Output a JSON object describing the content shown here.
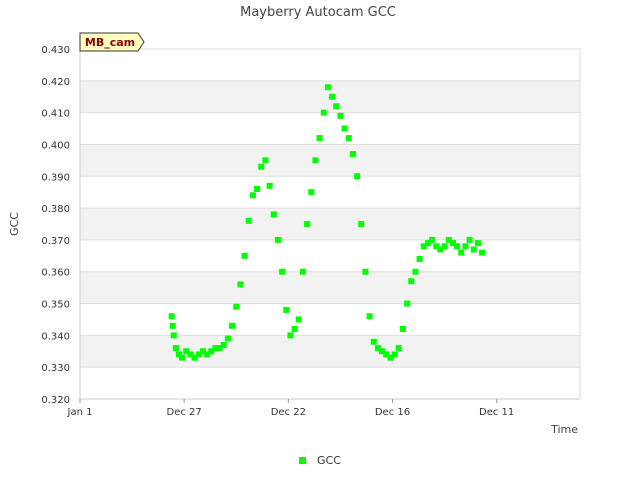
{
  "chart_data": {
    "type": "scatter",
    "title": "Mayberry Autocam GCC",
    "xlabel": "Time",
    "ylabel": "GCC",
    "ylim": [
      0.32,
      0.43
    ],
    "yticks": [
      "0.320",
      "0.330",
      "0.340",
      "0.350",
      "0.360",
      "0.370",
      "0.380",
      "0.390",
      "0.400",
      "0.410",
      "0.420",
      "0.430"
    ],
    "xlim": [
      0,
      24
    ],
    "xticks": [
      {
        "x": 0,
        "label": "Jan 1"
      },
      {
        "x": 5,
        "label": "Dec 27"
      },
      {
        "x": 10,
        "label": "Dec 22"
      },
      {
        "x": 15,
        "label": "Dec 16"
      },
      {
        "x": 20,
        "label": "Dec 11"
      }
    ],
    "grid": true,
    "legend_position": "bottom-center",
    "badge_label": "MB_cam",
    "series": [
      {
        "name": "GCC",
        "color": "#00ff00",
        "x": [
          4.4,
          4.45,
          4.5,
          4.6,
          4.75,
          4.9,
          5.1,
          5.3,
          5.5,
          5.7,
          5.9,
          6.1,
          6.3,
          6.5,
          6.7,
          6.9,
          7.1,
          7.3,
          7.5,
          7.7,
          7.9,
          8.1,
          8.3,
          8.5,
          8.7,
          8.9,
          9.1,
          9.3,
          9.5,
          9.7,
          9.9,
          10.1,
          10.3,
          10.5,
          10.7,
          10.9,
          11.1,
          11.3,
          11.5,
          11.7,
          11.9,
          12.1,
          12.3,
          12.5,
          12.7,
          12.9,
          13.1,
          13.3,
          13.5,
          13.7,
          13.9,
          14.1,
          14.3,
          14.5,
          14.7,
          14.9,
          15.1,
          15.3,
          15.5,
          15.7,
          15.9,
          16.1,
          16.3,
          16.5,
          16.7,
          16.9,
          17.1,
          17.3,
          17.5,
          17.7,
          17.9,
          18.1,
          18.3,
          18.5,
          18.7,
          18.9,
          19.1,
          19.3
        ],
        "y": [
          0.346,
          0.343,
          0.34,
          0.336,
          0.334,
          0.333,
          0.335,
          0.334,
          0.333,
          0.334,
          0.335,
          0.334,
          0.335,
          0.336,
          0.336,
          0.337,
          0.339,
          0.343,
          0.349,
          0.356,
          0.365,
          0.376,
          0.384,
          0.386,
          0.393,
          0.395,
          0.387,
          0.378,
          0.37,
          0.36,
          0.348,
          0.34,
          0.342,
          0.345,
          0.36,
          0.375,
          0.385,
          0.395,
          0.402,
          0.41,
          0.418,
          0.415,
          0.412,
          0.409,
          0.405,
          0.402,
          0.397,
          0.39,
          0.375,
          0.36,
          0.346,
          0.338,
          0.336,
          0.335,
          0.334,
          0.333,
          0.334,
          0.336,
          0.342,
          0.35,
          0.357,
          0.36,
          0.364,
          0.368,
          0.369,
          0.37,
          0.368,
          0.367,
          0.368,
          0.37,
          0.369,
          0.368,
          0.366,
          0.368,
          0.37,
          0.367,
          0.369,
          0.366
        ]
      }
    ]
  }
}
